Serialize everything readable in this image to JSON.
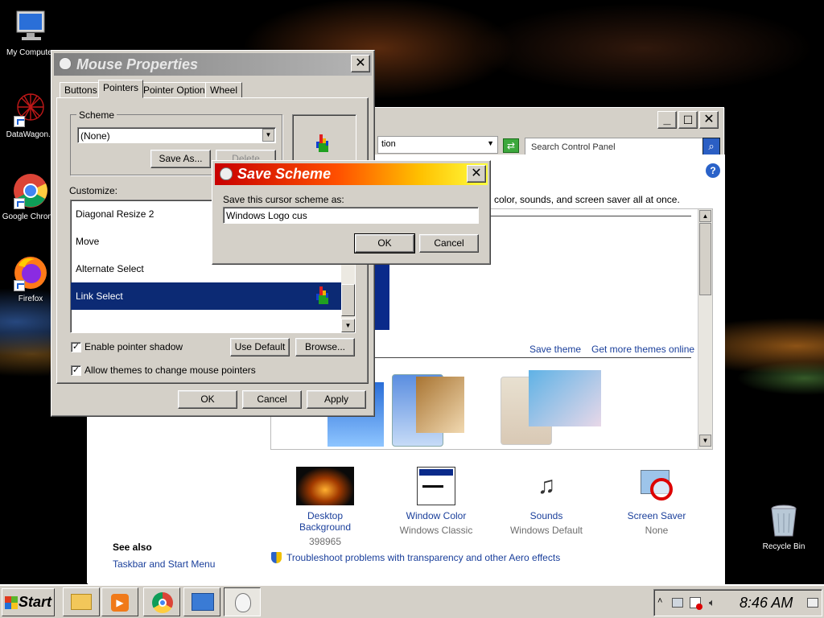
{
  "desktop": {
    "icons": [
      {
        "label": "My Computer"
      },
      {
        "label": "DataWagon..."
      },
      {
        "label": "Google Chrome"
      },
      {
        "label": "Firefox"
      },
      {
        "label": "Recycle Bin"
      }
    ]
  },
  "control_panel": {
    "search_placeholder": "Search Control Panel",
    "address_fragment": "tion",
    "subtitle": "color, sounds, and screen saver all at once.",
    "save_theme": "Save theme",
    "get_more_themes": "Get more themes online",
    "items": [
      {
        "label": "Desktop Background",
        "value": "398965"
      },
      {
        "label": "Window Color",
        "value": "Windows Classic"
      },
      {
        "label": "Sounds",
        "value": "Windows Default"
      },
      {
        "label": "Screen Saver",
        "value": "None"
      }
    ],
    "see_also": "See also",
    "taskbar_link": "Taskbar and Start Menu",
    "troubleshoot": "Troubleshoot problems with transparency and other Aero effects"
  },
  "mouse_properties": {
    "title": "Mouse Properties",
    "tabs": [
      "Buttons",
      "Pointers",
      "Pointer Options",
      "Wheel"
    ],
    "active_tab": "Pointers",
    "scheme_label": "Scheme",
    "scheme_value": "(None)",
    "save_as": "Save As...",
    "delete": "Delete",
    "customize_label": "Customize:",
    "pointer_rows": [
      "Diagonal Resize 2",
      "Move",
      "Alternate Select",
      "Link Select"
    ],
    "enable_shadow": "Enable pointer shadow",
    "use_default": "Use Default",
    "browse": "Browse...",
    "allow_themes": "Allow themes to change mouse pointers",
    "ok": "OK",
    "cancel": "Cancel",
    "apply": "Apply"
  },
  "save_scheme": {
    "title": "Save Scheme",
    "prompt": "Save this cursor scheme as:",
    "input_value": "Windows Logo cus",
    "ok": "OK",
    "cancel": "Cancel"
  },
  "taskbar": {
    "start": "Start",
    "clock": "8:46 AM"
  }
}
